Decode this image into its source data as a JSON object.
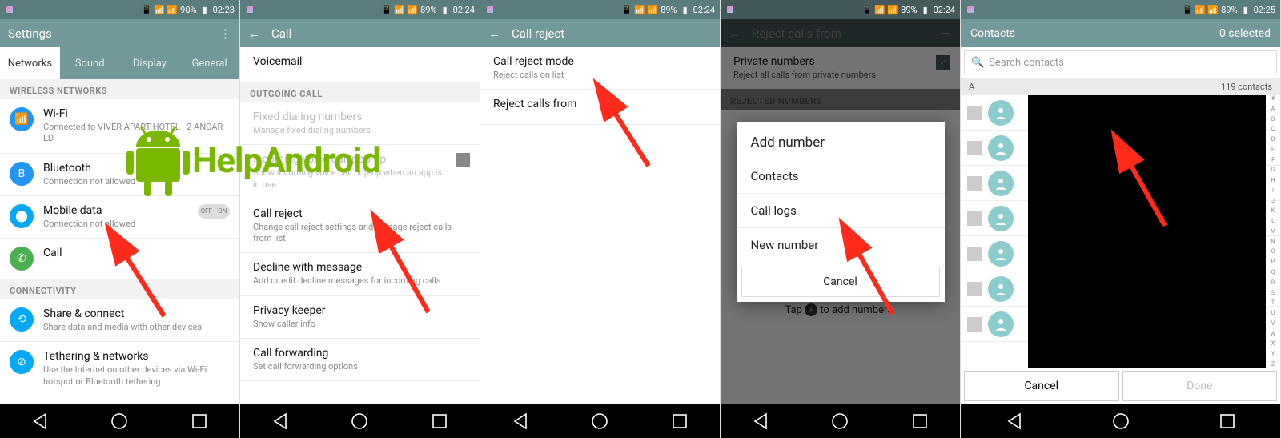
{
  "watermark_text": "HelpAndroid",
  "panel1": {
    "status": {
      "battery": "90%",
      "time": "02:23"
    },
    "app_title": "Settings",
    "tabs": [
      "Networks",
      "Sound",
      "Display",
      "General"
    ],
    "subheader1": "WIRELESS NETWORKS",
    "wifi": {
      "title": "Wi-Fi",
      "sub": "Connected to VIVER APART HOTEL - 2 ANDAR LD"
    },
    "bluetooth": {
      "title": "Bluetooth",
      "sub": "Connection not allowed"
    },
    "mobile": {
      "title": "Mobile data",
      "sub": "Connection not allowed",
      "toggle_off": "OFF",
      "toggle_on": "ON"
    },
    "call": {
      "title": "Call"
    },
    "subheader2": "CONNECTIVITY",
    "share": {
      "title": "Share & connect",
      "sub": "Share data and media with other devices"
    },
    "tether": {
      "title": "Tethering & networks",
      "sub": "Use the Internet on other devices via Wi-Fi hotspot or Bluetooth tethering"
    }
  },
  "panel2": {
    "status": {
      "battery": "89%",
      "time": "02:24"
    },
    "app_title": "Call",
    "voicemail": "Voicemail",
    "sub_outgoing": "OUTGOING CALL",
    "fixed": {
      "title": "Fixed dialing numbers",
      "sub": "Manage fixed dialing numbers"
    },
    "popup": {
      "title": "Incoming voice call pop-up",
      "sub": "Show incoming voice call pop-up when an app is in use"
    },
    "reject": {
      "title": "Call reject",
      "sub": "Change call reject settings and manage reject calls from list"
    },
    "decline": {
      "title": "Decline with message",
      "sub": "Add or edit decline messages for incoming calls"
    },
    "privacy": {
      "title": "Privacy keeper",
      "sub": "Show caller info"
    },
    "forward": {
      "title": "Call forwarding",
      "sub": "Set call forwarding options"
    }
  },
  "panel3": {
    "status": {
      "battery": "89%",
      "time": "02:24"
    },
    "app_title": "Call reject",
    "mode": {
      "title": "Call reject mode",
      "sub": "Reject calls on list"
    },
    "from": {
      "title": "Reject calls from"
    }
  },
  "panel4": {
    "status": {
      "battery": "89%",
      "time": "02:24"
    },
    "app_title": "Reject calls from",
    "private": {
      "title": "Private numbers",
      "sub": "Reject all calls from private numbers"
    },
    "sub_rejected": "REJECTED NUMBERS",
    "dialog_title": "Add number",
    "opt_contacts": "Contacts",
    "opt_logs": "Call logs",
    "opt_new": "New number",
    "cancel": "Cancel",
    "hint_a": "Tap ",
    "hint_b": " to add numbers."
  },
  "panel5": {
    "status": {
      "battery": "89%",
      "time": "02:25"
    },
    "app_title": "Contacts",
    "selected": "0 selected",
    "search_placeholder": "Search contacts",
    "section_letter": "A",
    "section_count": "119 contacts",
    "alpha": "# A B C D E F G H I J K L M N O P Q R S T U V W X Y Z",
    "cancel": "Cancel",
    "done": "Done"
  }
}
